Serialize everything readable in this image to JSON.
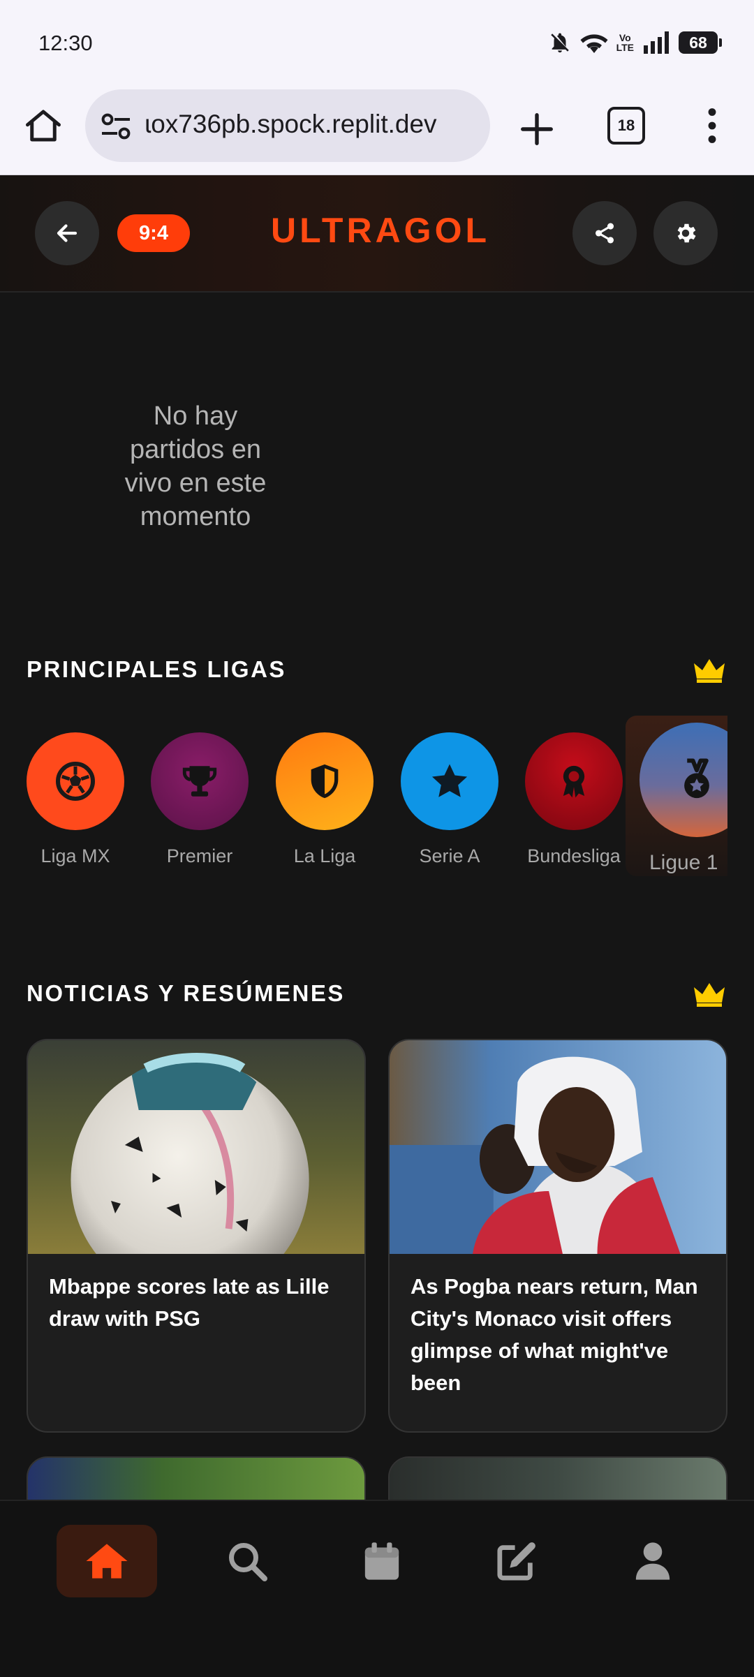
{
  "status_bar": {
    "time": "12:30",
    "battery": "68",
    "volte_top": "Vo",
    "volte_bottom": "LTE",
    "icons": [
      "bell-off-icon",
      "wifi-icon",
      "volte-icon",
      "signal-icon",
      "battery-icon"
    ]
  },
  "browser": {
    "url": "ɩox736pb.spock.replit.dev",
    "tab_count": "18",
    "icons": [
      "home-icon",
      "site-settings-icon",
      "plus-icon",
      "tabs-icon",
      "more-vert-icon"
    ]
  },
  "header": {
    "score_badge": "9:4",
    "title": "ULTRAGOL",
    "icons": [
      "arrow-left-icon",
      "share-icon",
      "gear-icon"
    ],
    "accent_color": "#ff4a12"
  },
  "live": {
    "empty_message": "No hay partidos en vivo en este momento"
  },
  "leagues_section": {
    "title": "PRINCIPALES LIGAS",
    "icon": "crown-icon",
    "items": [
      {
        "name": "Liga MX",
        "icon": "soccer-ball-icon",
        "color": "#ff4a1c"
      },
      {
        "name": "Premier",
        "icon": "trophy-icon",
        "color": "#7a1a5e"
      },
      {
        "name": "La Liga",
        "icon": "shield-icon",
        "color": "#ff9a10"
      },
      {
        "name": "Serie A",
        "icon": "star-icon",
        "color": "#0d8fe0"
      },
      {
        "name": "Bundesliga",
        "icon": "award-icon",
        "color": "#b00a14"
      },
      {
        "name": "Ligue 1",
        "icon": "medal-icon",
        "color": "#4a70b0"
      }
    ]
  },
  "news_section": {
    "title": "NOTICIAS Y RESÚMENES",
    "icon": "crown-icon",
    "articles": [
      {
        "title": "Mbappe scores late as Lille draw with PSG"
      },
      {
        "title": "As Pogba nears return, Man City's Monaco visit offers glimpse of what might've been"
      }
    ]
  },
  "bottom_nav": {
    "items": [
      {
        "icon": "home-icon",
        "active": true
      },
      {
        "icon": "search-icon",
        "active": false
      },
      {
        "icon": "calendar-icon",
        "active": false
      },
      {
        "icon": "edit-icon",
        "active": false
      },
      {
        "icon": "user-icon",
        "active": false
      }
    ]
  }
}
